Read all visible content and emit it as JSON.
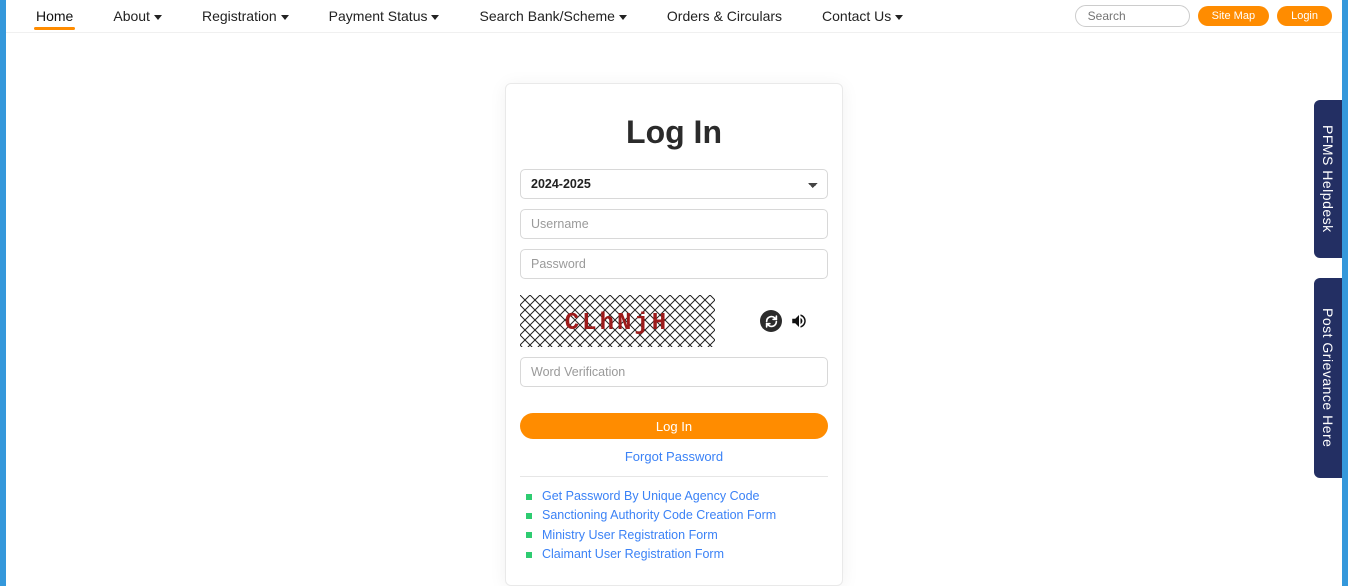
{
  "nav": {
    "items": [
      {
        "label": "Home",
        "dropdown": false,
        "active": true
      },
      {
        "label": "About",
        "dropdown": true
      },
      {
        "label": "Registration",
        "dropdown": true
      },
      {
        "label": "Payment Status",
        "dropdown": true
      },
      {
        "label": "Search Bank/Scheme",
        "dropdown": true
      },
      {
        "label": "Orders & Circulars",
        "dropdown": false
      },
      {
        "label": "Contact Us",
        "dropdown": true
      }
    ],
    "search_placeholder": "Search",
    "sitemap_label": "Site Map",
    "login_label": "Login"
  },
  "login": {
    "title": "Log In",
    "year_selected": "2024-2025",
    "username_placeholder": "Username",
    "password_placeholder": "Password",
    "captcha_text": "CLhNjH",
    "word_verification_placeholder": "Word Verification",
    "submit_label": "Log In",
    "forgot_label": "Forgot Password",
    "links": [
      "Get Password By Unique Agency Code",
      "Sanctioning Authority Code Creation Form",
      "Ministry User Registration Form",
      "Claimant User Registration Form"
    ]
  },
  "side_tabs": {
    "helpdesk": "PFMS Helpdesk",
    "grievance": "Post Grievance Here"
  }
}
